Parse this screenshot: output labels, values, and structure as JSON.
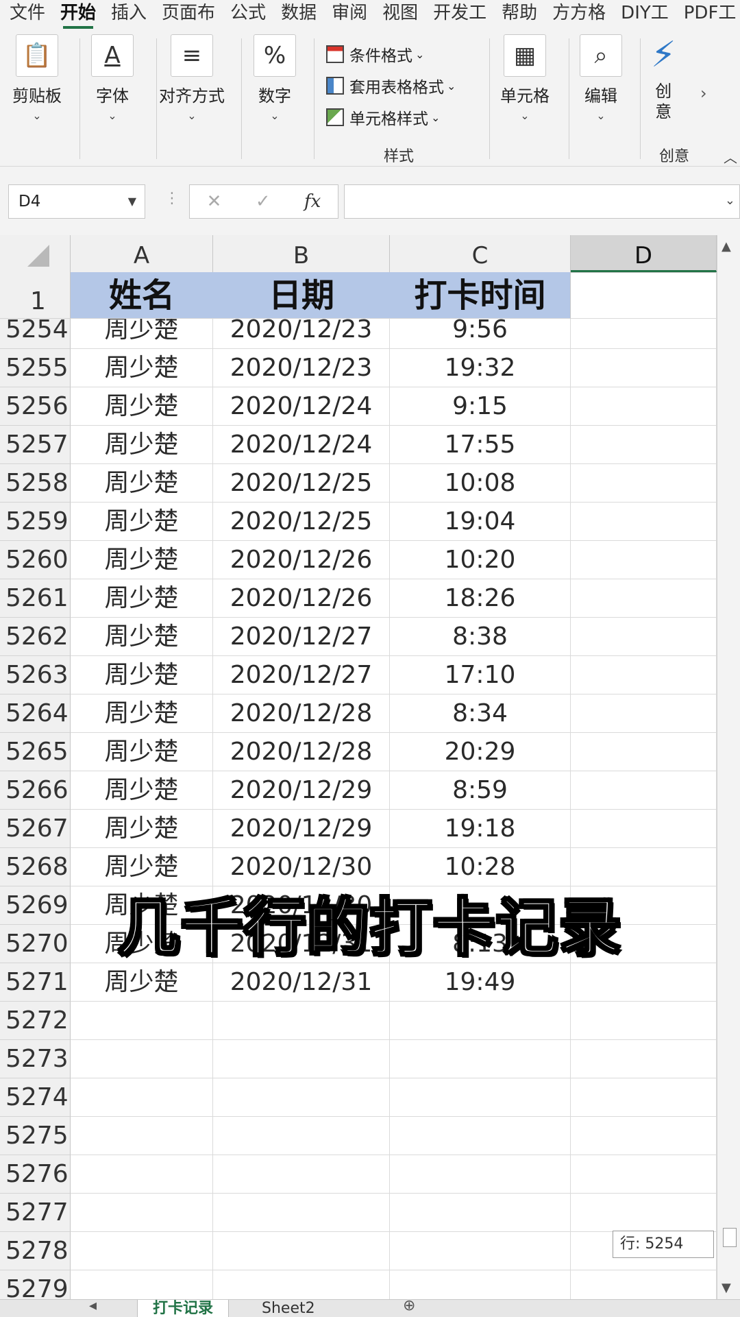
{
  "ribbon_tabs": [
    "文件",
    "开始",
    "插入",
    "页面布",
    "公式",
    "数据",
    "审阅",
    "视图",
    "开发工",
    "帮助",
    "方方格",
    "DIY工",
    "PDF工"
  ],
  "active_tab_index": 1,
  "ribbon": {
    "clipboard": "剪贴板",
    "font": "字体",
    "alignment": "对齐方式",
    "number": "数字",
    "conditional_format": "条件格式",
    "table_format": "套用表格格式",
    "cell_styles": "单元格样式",
    "styles_group": "样式",
    "cells": "单元格",
    "edit": "编辑",
    "creative_btn": "创\n意",
    "creative_group": "创意"
  },
  "formula_bar": {
    "name_box": "D4",
    "cancel": "✕",
    "confirm": "✓",
    "fx": "fx",
    "formula": ""
  },
  "columns": [
    "A",
    "B",
    "C",
    "D"
  ],
  "selected_column": "D",
  "header_row": {
    "number": "1",
    "cells": [
      "姓名",
      "日期",
      "打卡时间",
      ""
    ]
  },
  "rows": [
    {
      "n": "5254",
      "name": "周少楚",
      "date": "2020/12/23",
      "time": "9:56"
    },
    {
      "n": "5255",
      "name": "周少楚",
      "date": "2020/12/23",
      "time": "19:32"
    },
    {
      "n": "5256",
      "name": "周少楚",
      "date": "2020/12/24",
      "time": "9:15"
    },
    {
      "n": "5257",
      "name": "周少楚",
      "date": "2020/12/24",
      "time": "17:55"
    },
    {
      "n": "5258",
      "name": "周少楚",
      "date": "2020/12/25",
      "time": "10:08"
    },
    {
      "n": "5259",
      "name": "周少楚",
      "date": "2020/12/25",
      "time": "19:04"
    },
    {
      "n": "5260",
      "name": "周少楚",
      "date": "2020/12/26",
      "time": "10:20"
    },
    {
      "n": "5261",
      "name": "周少楚",
      "date": "2020/12/26",
      "time": "18:26"
    },
    {
      "n": "5262",
      "name": "周少楚",
      "date": "2020/12/27",
      "time": "8:38"
    },
    {
      "n": "5263",
      "name": "周少楚",
      "date": "2020/12/27",
      "time": "17:10"
    },
    {
      "n": "5264",
      "name": "周少楚",
      "date": "2020/12/28",
      "time": "8:34"
    },
    {
      "n": "5265",
      "name": "周少楚",
      "date": "2020/12/28",
      "time": "20:29"
    },
    {
      "n": "5266",
      "name": "周少楚",
      "date": "2020/12/29",
      "time": "8:59"
    },
    {
      "n": "5267",
      "name": "周少楚",
      "date": "2020/12/29",
      "time": "19:18"
    },
    {
      "n": "5268",
      "name": "周少楚",
      "date": "2020/12/30",
      "time": "10:28"
    },
    {
      "n": "5269",
      "name": "周少楚",
      "date": "2020/12/30",
      "time": ""
    },
    {
      "n": "5270",
      "name": "周少楚",
      "date": "2020/12/31",
      "time": "8:13"
    },
    {
      "n": "5271",
      "name": "周少楚",
      "date": "2020/12/31",
      "time": "19:49"
    },
    {
      "n": "5272",
      "name": "",
      "date": "",
      "time": ""
    },
    {
      "n": "5273",
      "name": "",
      "date": "",
      "time": ""
    },
    {
      "n": "5274",
      "name": "",
      "date": "",
      "time": ""
    },
    {
      "n": "5275",
      "name": "",
      "date": "",
      "time": ""
    },
    {
      "n": "5276",
      "name": "",
      "date": "",
      "time": ""
    },
    {
      "n": "5277",
      "name": "",
      "date": "",
      "time": ""
    },
    {
      "n": "5278",
      "name": "",
      "date": "",
      "time": ""
    },
    {
      "n": "5279",
      "name": "",
      "date": "",
      "time": ""
    }
  ],
  "scroll_tooltip": "行: 5254",
  "sheet_tabs": [
    "打卡记录",
    "Sheet2"
  ],
  "active_sheet_index": 0,
  "caption": "几千行的打卡记录"
}
